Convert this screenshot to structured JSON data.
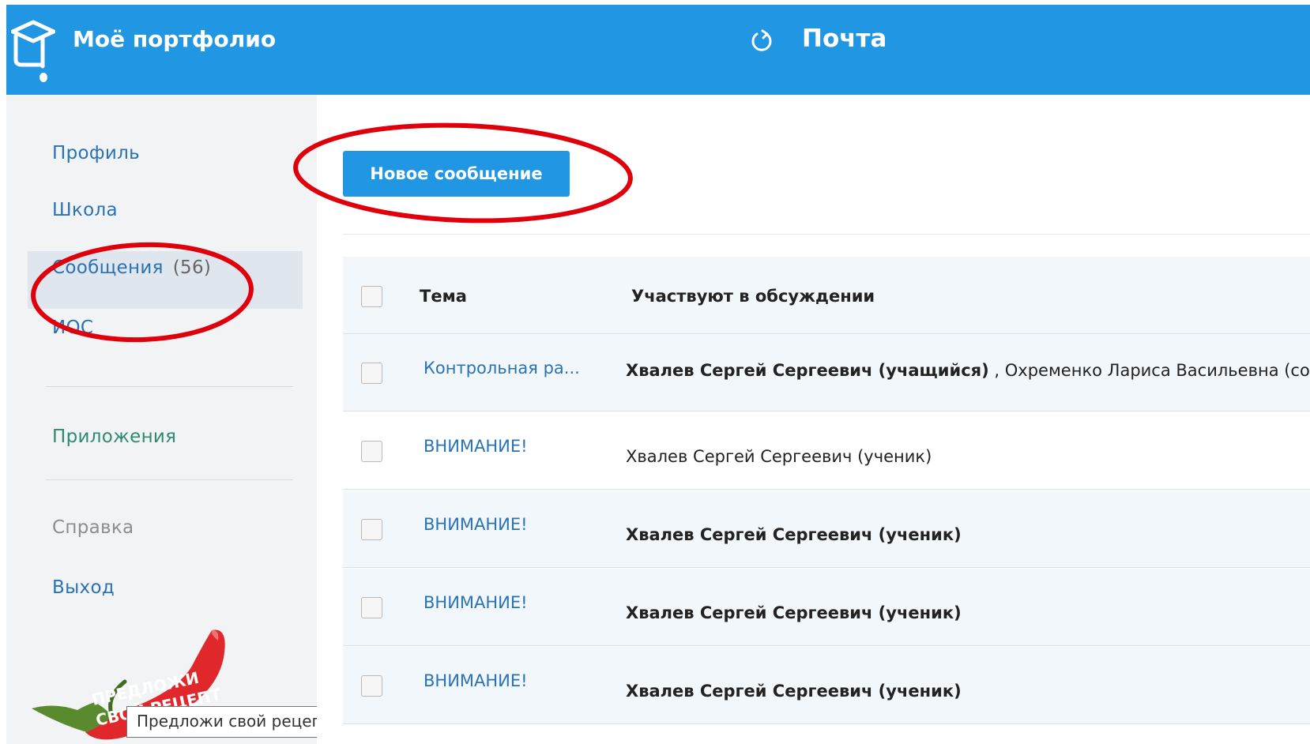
{
  "header": {
    "app_title": "Моё портфолио",
    "page_title": "Почта",
    "color": "#2196e3"
  },
  "sidebar": {
    "items": [
      {
        "label": "Профиль"
      },
      {
        "label": "Школа"
      },
      {
        "label": "Сообщения",
        "count": "(56)"
      },
      {
        "label": "ИОС"
      },
      {
        "label": "Приложения"
      },
      {
        "label": "Справка"
      },
      {
        "label": "Выход"
      }
    ],
    "promo_text_line1": "ПРЕДЛОЖИ",
    "promo_text_line2": "СВОЙ РЕЦЕПТ",
    "tooltip": "Предложи свой рецепт"
  },
  "main": {
    "new_message_label": "Новое сообщение",
    "columns": {
      "subject": "Тема",
      "participants": "Участвуют в обсуждении"
    },
    "rows": [
      {
        "subject": "Контрольная ра...",
        "participant_bold": "Хвалев Сергей Сергеевич (учащийся)",
        "participant_rest": " , Охременко Лариса Васильевна (сотр"
      },
      {
        "subject": "ВНИМАНИЕ!",
        "participant_bold": "",
        "participant_rest": "Хвалев Сергей Сергеевич (ученик)"
      },
      {
        "subject": "ВНИМАНИЕ!",
        "participant_bold": "Хвалев Сергей Сергеевич (ученик)",
        "participant_rest": ""
      },
      {
        "subject": "ВНИМАНИЕ!",
        "participant_bold": "Хвалев Сергей Сергеевич (ученик)",
        "participant_rest": ""
      },
      {
        "subject": "ВНИМАНИЕ!",
        "participant_bold": "Хвалев Сергей Сергеевич (ученик)",
        "participant_rest": ""
      }
    ]
  },
  "annotation_color": "#e0000b"
}
